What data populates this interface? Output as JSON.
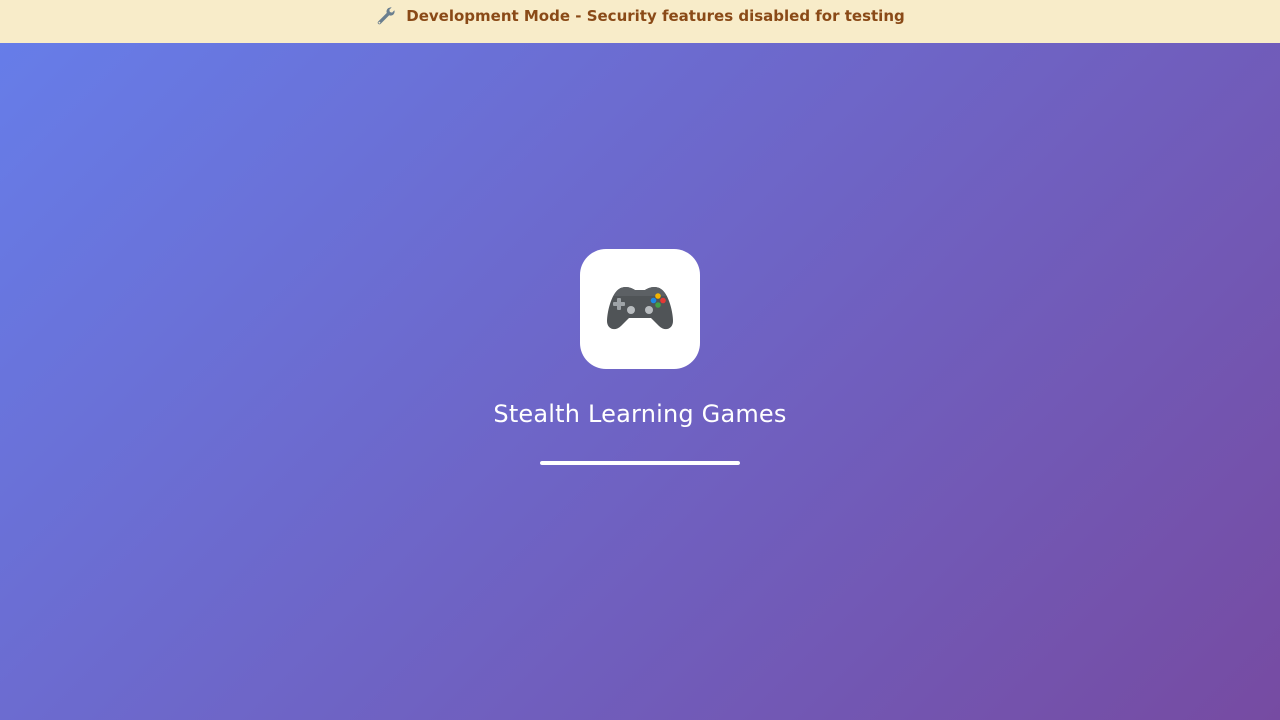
{
  "banner": {
    "icon": "wrench-icon",
    "text": "Development Mode - Security features disabled for testing",
    "background_color": "#f8ecc9",
    "text_color": "#8a4a17"
  },
  "splash": {
    "logo_icon": "game-controller-icon",
    "title": "Stealth Learning Games",
    "loading_progress": 1.0
  },
  "colors": {
    "background_gradient_start": "#667eea",
    "background_gradient_end": "#764ba2"
  }
}
